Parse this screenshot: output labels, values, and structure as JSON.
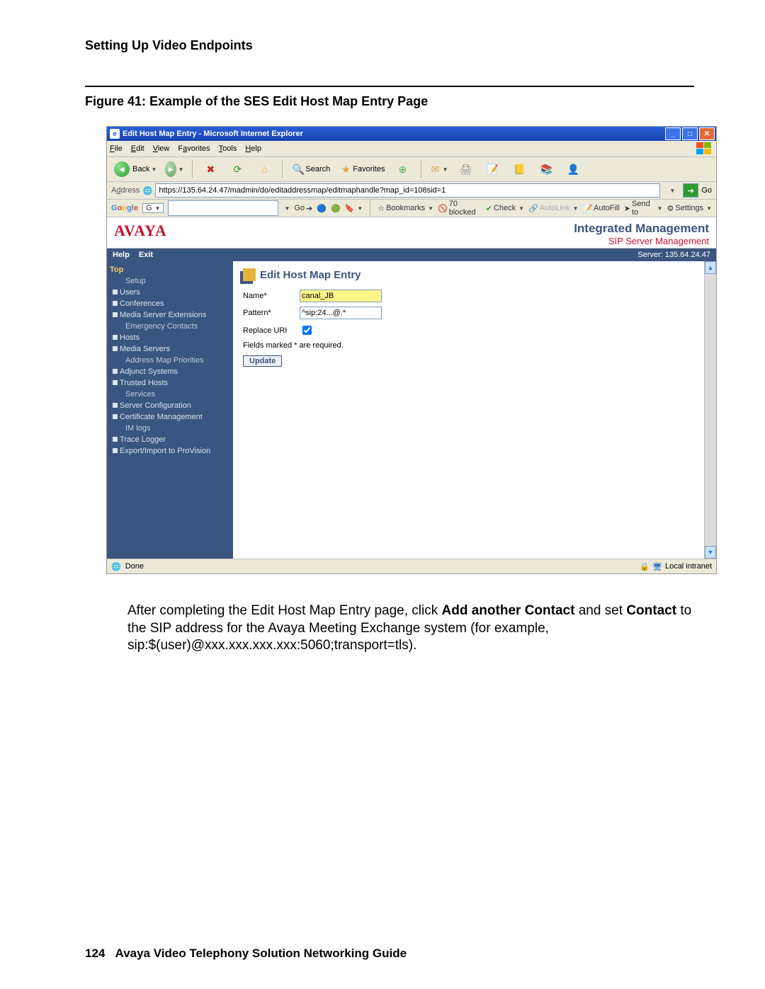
{
  "doc": {
    "section_header": "Setting Up Video Endpoints",
    "figure_caption": "Figure 41: Example of the SES Edit Host Map Entry Page",
    "paragraph_prefix": "After completing the Edit Host Map Entry page, click ",
    "paragraph_bold1": "Add another Contact",
    "paragraph_mid": " and set ",
    "paragraph_bold2": "Contact",
    "paragraph_suffix": " to the SIP address for the Avaya Meeting Exchange system (for example, sip:$(user)@xxx.xxx.xxx.xxx:5060;transport=tls).",
    "page_number": "124",
    "footer_title": "Avaya Video Telephony Solution Networking Guide"
  },
  "ie": {
    "title": "Edit Host Map Entry - Microsoft Internet Explorer",
    "menus": {
      "file": "File",
      "edit": "Edit",
      "view": "View",
      "favorites": "Favorites",
      "tools": "Tools",
      "help": "Help"
    },
    "toolbar": {
      "back": "Back",
      "search": "Search",
      "favorites": "Favorites"
    },
    "address_label": "Address",
    "address": "https://135.64.24.47/madmin/do/editaddressmap/editmaphandle?map_id=108sid=1",
    "go_label": "Go",
    "google": {
      "brand": "Google",
      "go": "Go",
      "bookmarks": "Bookmarks",
      "blocked": "70 blocked",
      "check": "Check",
      "autolink": "AutoLink",
      "autofill": "AutoFill",
      "sendto": "Send to",
      "settings": "Settings"
    },
    "status_done": "Done",
    "status_zone": "Local intranet"
  },
  "app": {
    "logo": "AVAYA",
    "brand_line1": "Integrated Management",
    "brand_line2": "SIP Server Management",
    "help": "Help",
    "exit": "Exit",
    "server_label": "Server: 135.64.24.47",
    "nav": {
      "top": "Top",
      "setup": "Setup",
      "users": "Users",
      "conferences": "Conferences",
      "mse": "Media Server Extensions",
      "emergency": "Emergency Contacts",
      "hosts": "Hosts",
      "mediaservers": "Media Servers",
      "amp": "Address Map Priorities",
      "adjunct": "Adjunct Systems",
      "trusted": "Trusted Hosts",
      "services": "Services",
      "serverconf": "Server Configuration",
      "certmgmt": "Certificate Management",
      "imlogs": "IM logs",
      "trace": "Trace Logger",
      "export": "Export/Import to ProVision"
    },
    "form": {
      "title": "Edit Host Map Entry",
      "name_label": "Name*",
      "name_value": "canal_JB",
      "pattern_label": "Pattern*",
      "pattern_value": "^sip:24...@.*",
      "replace_label": "Replace URI",
      "replace_checked": true,
      "required_note": "Fields marked * are required.",
      "update": "Update"
    }
  }
}
